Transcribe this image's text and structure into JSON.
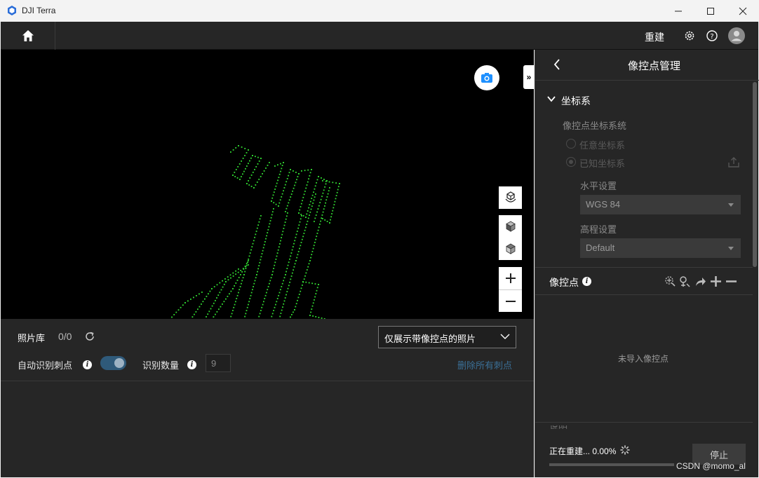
{
  "window": {
    "title": "DJI Terra"
  },
  "appbar": {
    "rebuild_label": "重建"
  },
  "bottom": {
    "photo_library_label": "照片库",
    "photo_count": "0/0",
    "filter_selected": "仅展示带像控点的照片",
    "auto_detect_label": "自动识别刺点",
    "auto_detect_on": true,
    "detect_count_label": "识别数量",
    "detect_count_value": "9",
    "delete_all_label": "删除所有刺点"
  },
  "right": {
    "title": "像控点管理",
    "coord_section_label": "坐标系",
    "gcp_coord_system_label": "像控点坐标系统",
    "arbitrary_label": "任意坐标系",
    "known_label": "已知坐标系",
    "horizontal_label": "水平设置",
    "horizontal_value": "WGS 84",
    "vertical_label": "高程设置",
    "vertical_value": "Default",
    "gcp_label": "像控点",
    "empty_text": "未导入像控点",
    "truncated_section_label": "说明",
    "status_text": "正在重建... 0.00%",
    "progress_fraction": 0.0,
    "stop_label": "停止"
  },
  "watermark": "CSDN @momo_al",
  "colors": {
    "accent": "#1e90ff",
    "toggle": "#2f5a7a",
    "points": "#33dd33"
  }
}
